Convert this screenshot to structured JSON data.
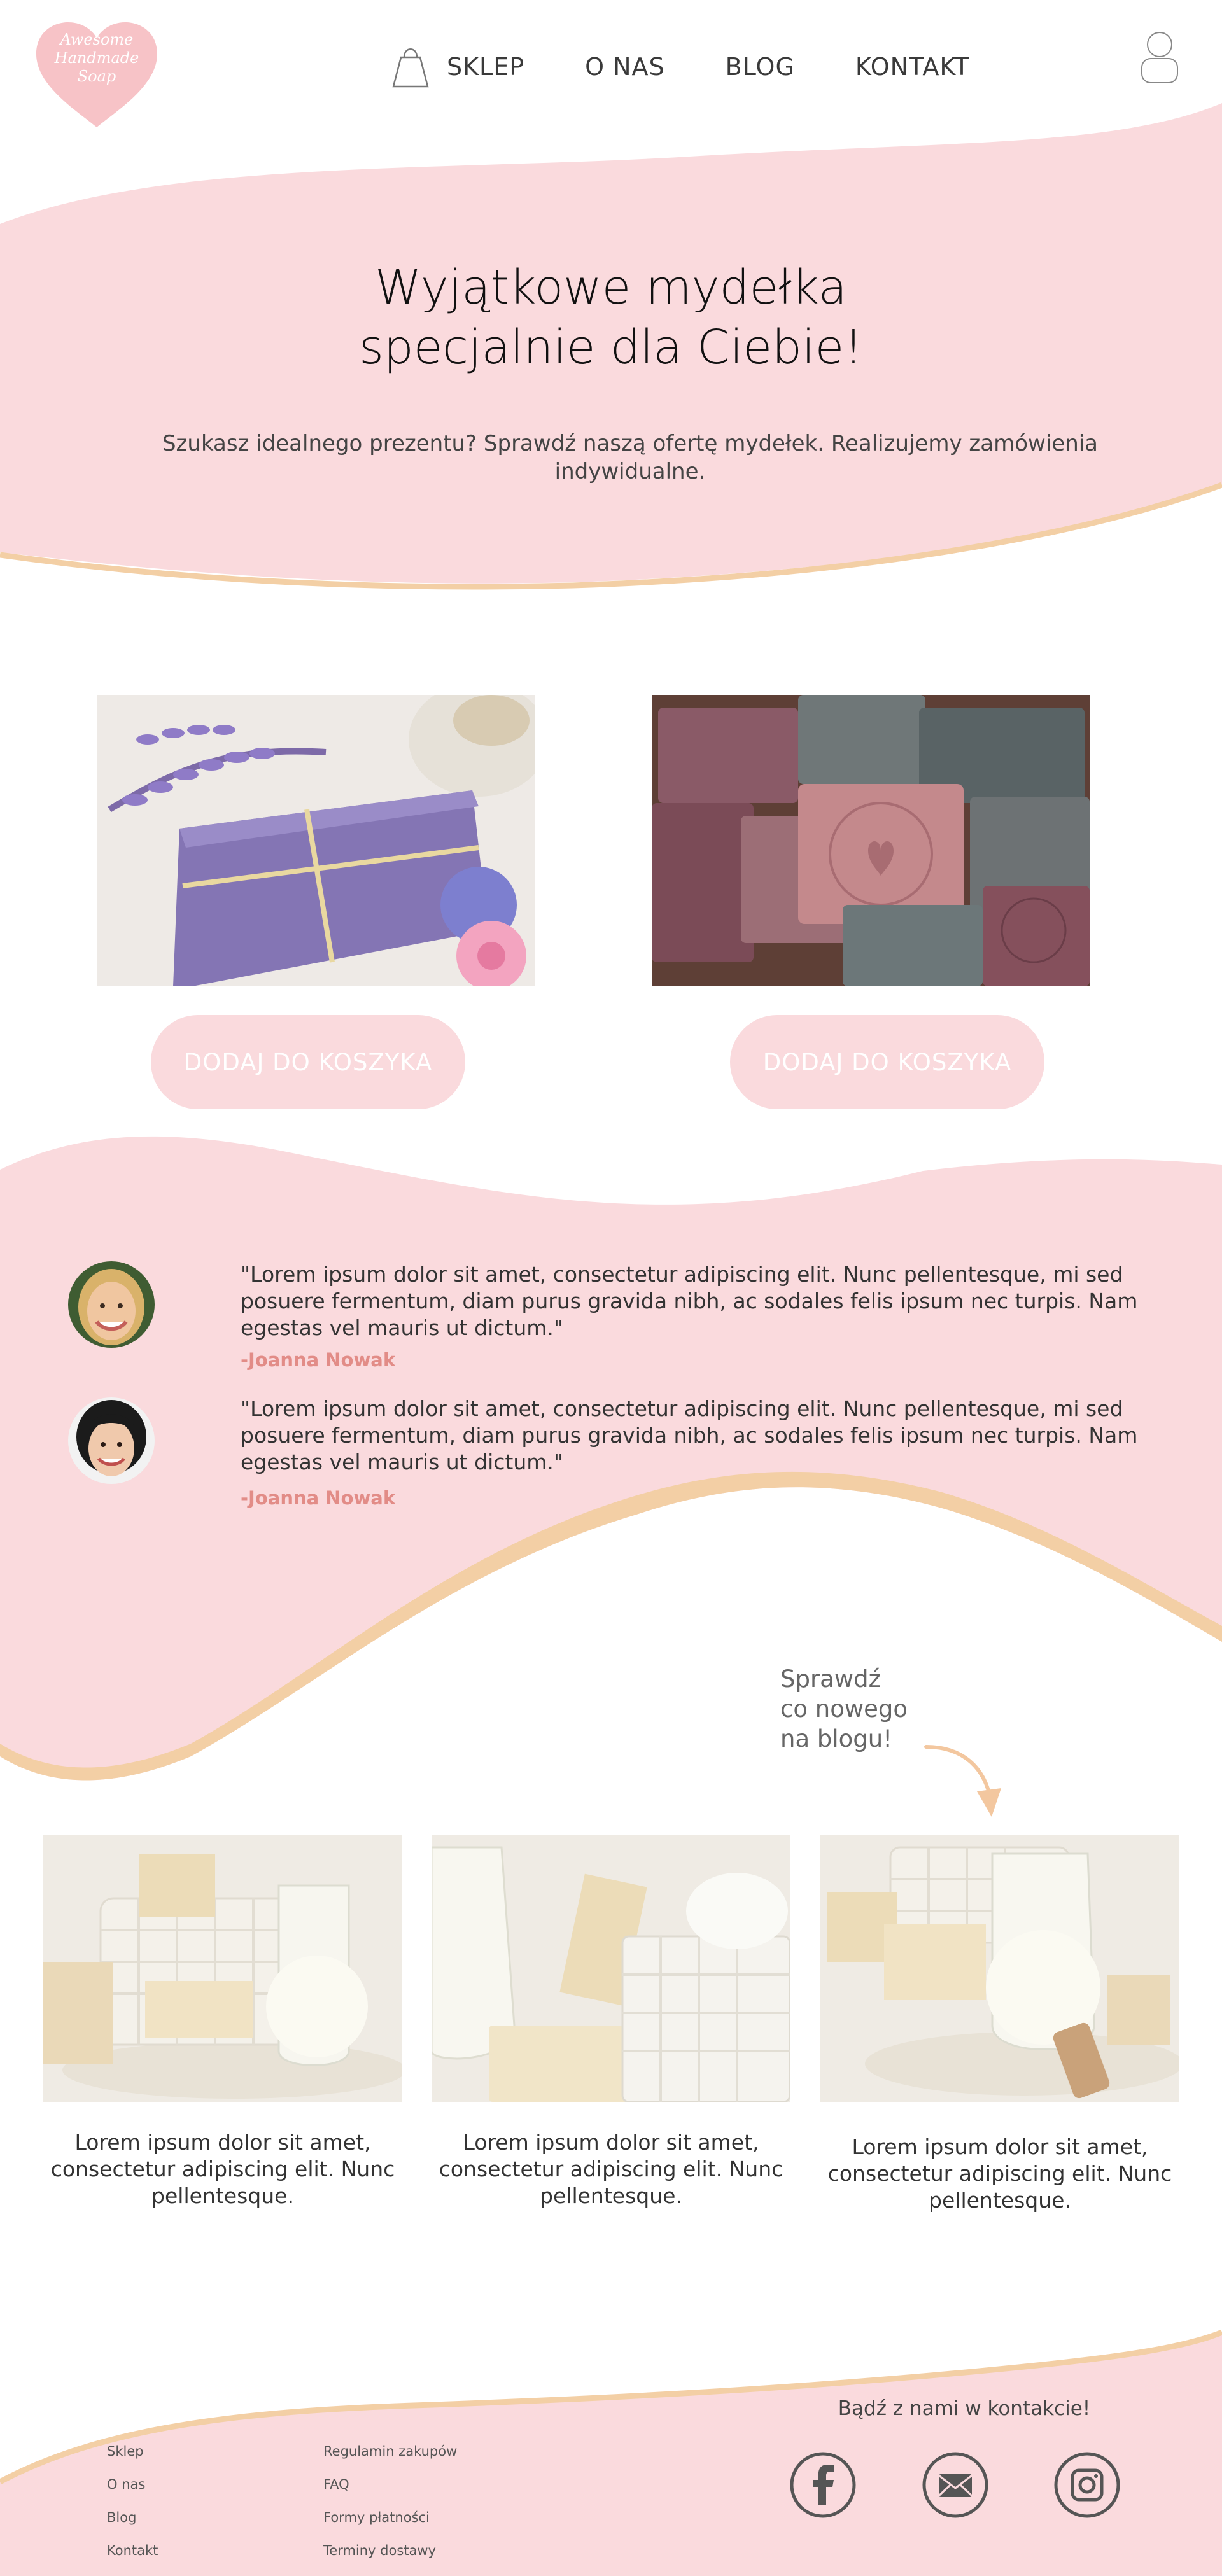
{
  "colors": {
    "pink": "#fadadd",
    "peach": "#f3cfa5",
    "author": "#e28c87",
    "button_text": "#ffffff"
  },
  "logo": {
    "line1": "Awesome",
    "line2": "Handmade",
    "line3": "Soap"
  },
  "nav": {
    "shop_icon": "shopping-bag-icon",
    "items": [
      "SKLEP",
      "O NAS",
      "BLOG",
      "KONTAKT"
    ],
    "user_icon": "user-icon"
  },
  "hero": {
    "title_line1": "Wyjątkowe mydełka",
    "title_line2": "specjalnie dla Ciebie!",
    "subtitle": "Szukasz idealnego prezentu? Sprawdź naszą ofertę mydełek. Realizujemy zamówienia indywidualne."
  },
  "products": [
    {
      "button": "DODAJ DO KOSZYKA"
    },
    {
      "button": "DODAJ DO KOSZYKA"
    }
  ],
  "testimonials": [
    {
      "quote": "\"Lorem ipsum dolor sit amet, consectetur adipiscing elit. Nunc pellentesque, mi sed posuere fermentum, diam purus gravida nibh, ac sodales felis ipsum nec turpis. Nam egestas vel mauris ut dictum.\"",
      "author": "-Joanna Nowak"
    },
    {
      "quote": "\"Lorem ipsum dolor sit amet, consectetur adipiscing elit. Nunc pellentesque, mi sed posuere fermentum, diam purus gravida nibh, ac sodales felis ipsum nec turpis. Nam egestas vel mauris ut dictum.\"",
      "author": "-Joanna Nowak"
    }
  ],
  "blog": {
    "teaser_line1": "Sprawdź",
    "teaser_line2": "co nowego",
    "teaser_line3": "na blogu!",
    "posts": [
      {
        "caption": "Lorem ipsum dolor sit amet, consectetur adipiscing elit. Nunc pellentesque."
      },
      {
        "caption": "Lorem ipsum dolor sit amet, consectetur adipiscing elit. Nunc pellentesque."
      },
      {
        "caption": "Lorem ipsum dolor sit amet, consectetur adipiscing elit. Nunc pellentesque."
      }
    ]
  },
  "footer": {
    "col1": [
      "Sklep",
      "O nas",
      "Blog",
      "Kontakt"
    ],
    "col2": [
      "Regulamin zakupów",
      "FAQ",
      "Formy płatności",
      "Terminy dostawy"
    ],
    "contact_heading": "Bądź z nami w kontakcie!",
    "social_icons": [
      "facebook-icon",
      "mail-icon",
      "instagram-icon"
    ]
  }
}
